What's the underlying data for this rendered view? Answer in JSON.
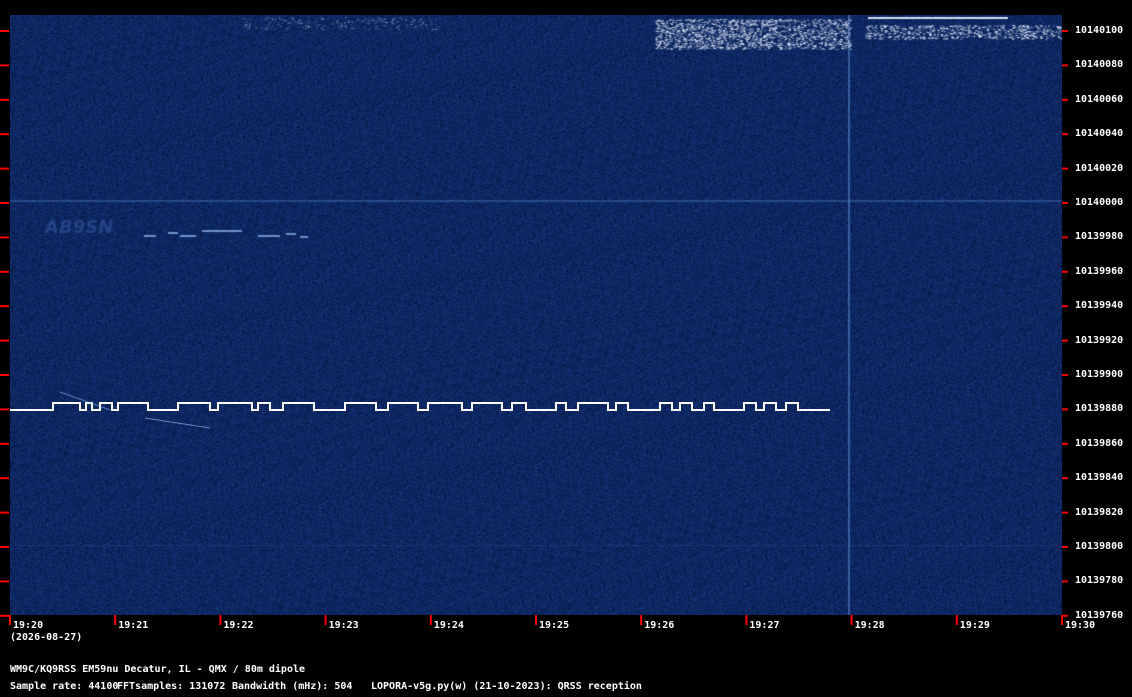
{
  "y_axis": {
    "labels": [
      "10140100",
      "10140080",
      "10140060",
      "10140040",
      "10140020",
      "10140000",
      "10139980",
      "10139960",
      "10139940",
      "10139920",
      "10139900",
      "10139880",
      "10139860",
      "10139840",
      "10139820",
      "10139800",
      "10139780",
      "10139760"
    ]
  },
  "x_axis": {
    "labels": [
      "19:20",
      "19:21",
      "19:22",
      "19:23",
      "19:24",
      "19:25",
      "19:26",
      "19:27",
      "19:28",
      "19:29",
      "19:30"
    ],
    "date": "(2026-08-27)"
  },
  "footer": {
    "station": "WM9C/KQ9RSS EM59nu Decatur, IL - QMX / 80m dipole",
    "sample_rate": "Sample rate: 44100",
    "fft_samples": "FFTsamples: 131072",
    "bandwidth": "Bandwidth (mHz): 504",
    "software": "LOPORA-v5g.py(w) (21-10-2023): QRSS reception"
  },
  "colors": {
    "background": "#000000",
    "spectrogram": "#0a1f55",
    "tick": "#ff0000",
    "signal": "#ffffff"
  }
}
